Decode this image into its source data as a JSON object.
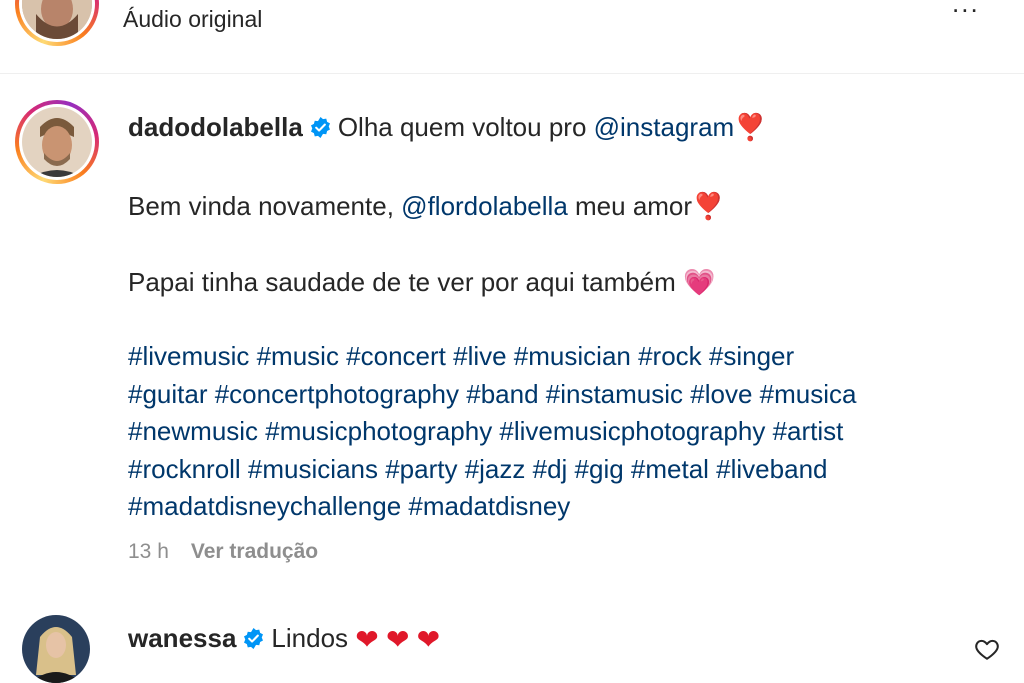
{
  "top": {
    "audio_label": "Áudio original",
    "more_label": "..."
  },
  "post": {
    "username": "dadodolabella",
    "line1_text": "Olha quem voltou pro",
    "line1_mention": "@instagram",
    "line1_emoji": "❣️",
    "line2_text": "Bem vinda novamente,",
    "line2_mention": "@flordolabella",
    "line2_after": "meu amor",
    "line2_emoji": "❣️",
    "line3_text": "Papai tinha saudade de te ver por aqui também",
    "line3_emoji": "💗",
    "hashtag_lines": [
      "#livemusic #music #concert #live #musician #rock #singer",
      "#guitar #concertphotography #band #instamusic #love #musica",
      "#newmusic #musicphotography #livemusicphotography #artist",
      "#rocknroll #musicians #party #jazz #dj #gig #metal #liveband",
      "#madatdisneychallenge #madatdisney"
    ],
    "time": "13 h",
    "translate_label": "Ver tradução"
  },
  "comment": {
    "username": "wanessa",
    "text": "Lindos",
    "emojis": [
      "❤",
      "❤",
      "❤"
    ]
  },
  "icons": {
    "verified": "verified-badge-icon",
    "heart": "heart-outline-icon",
    "more": "more-options-icon"
  },
  "colors": {
    "link": "#00376b",
    "verified": "#0095f6",
    "muted": "#8e8e8e",
    "heart_red": "#e0182a"
  }
}
